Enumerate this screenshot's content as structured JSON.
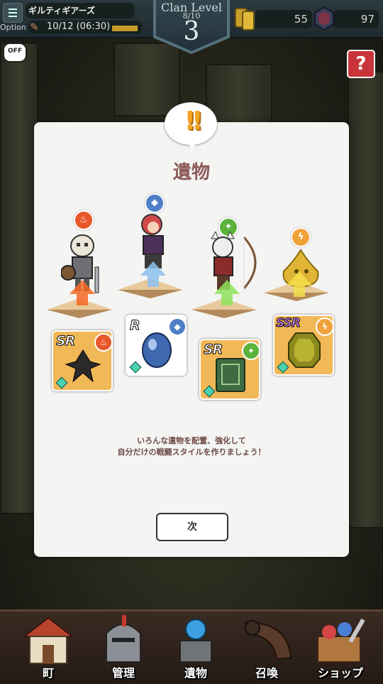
{
  "header": {
    "option_label": "Option",
    "clan_name": "ギルティギアーズ",
    "date": "10/12 (06:30)",
    "clan_level_title": "Clan Level",
    "clan_level_progress": "8/10",
    "clan_level": "3",
    "coins": "55",
    "gems": "97"
  },
  "toggle": {
    "label": "OFF"
  },
  "help": {
    "label": "?"
  },
  "modal": {
    "title": "遺物",
    "description_line1": "いろんな遺物を配置、強化して",
    "description_line2": "自分だけの戦闘スタイルを作りましょう！",
    "next_button": "次"
  },
  "characters": [
    {
      "name": "skeleton-knight",
      "element": "fire",
      "element_color": "#e8572a"
    },
    {
      "name": "red-haired-fighter",
      "element": "water",
      "element_color": "#4e7fc7"
    },
    {
      "name": "cat-archer",
      "element": "wind",
      "element_color": "#5bb33b"
    },
    {
      "name": "yellow-slime",
      "element": "thunder",
      "element_color": "#f0a23a"
    }
  ],
  "relics": [
    {
      "rarity": "SR",
      "element": "fire",
      "element_color": "#e8572a",
      "bg": "#f1b857"
    },
    {
      "rarity": "R",
      "element": "water",
      "element_color": "#4e7fc7",
      "bg": "#ffffff"
    },
    {
      "rarity": "SR",
      "element": "wind",
      "element_color": "#5bb33b",
      "bg": "#f1b857"
    },
    {
      "rarity": "SSR",
      "element": "thunder",
      "element_color": "#f0a23a",
      "bg": "#f1b857"
    }
  ],
  "nav": [
    {
      "label": "町"
    },
    {
      "label": "管理"
    },
    {
      "label": "遺物"
    },
    {
      "label": "召喚"
    },
    {
      "label": "ショップ"
    }
  ]
}
